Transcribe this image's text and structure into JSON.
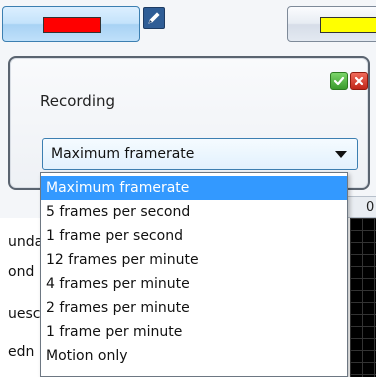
{
  "top_buttons": {
    "left_color": "#ff0000",
    "right_color": "#ffff00",
    "edit_icon": "pencil-icon"
  },
  "grid_header": {
    "partial_text": "0"
  },
  "background_list": {
    "labels": [
      "unda",
      "ond",
      "uesc",
      "edn"
    ]
  },
  "popup": {
    "title": "Recording",
    "ok_icon": "checkmark-icon",
    "close_icon": "close-x-icon",
    "select": {
      "value": "Maximum framerate"
    }
  },
  "dropdown": {
    "selected_index": 0,
    "options": [
      "Maximum framerate",
      "5 frames per second",
      "1 frame per second",
      "12 frames per minute",
      "4 frames per minute",
      "2 frames per minute",
      "1 frame per minute",
      "Motion only"
    ]
  }
}
